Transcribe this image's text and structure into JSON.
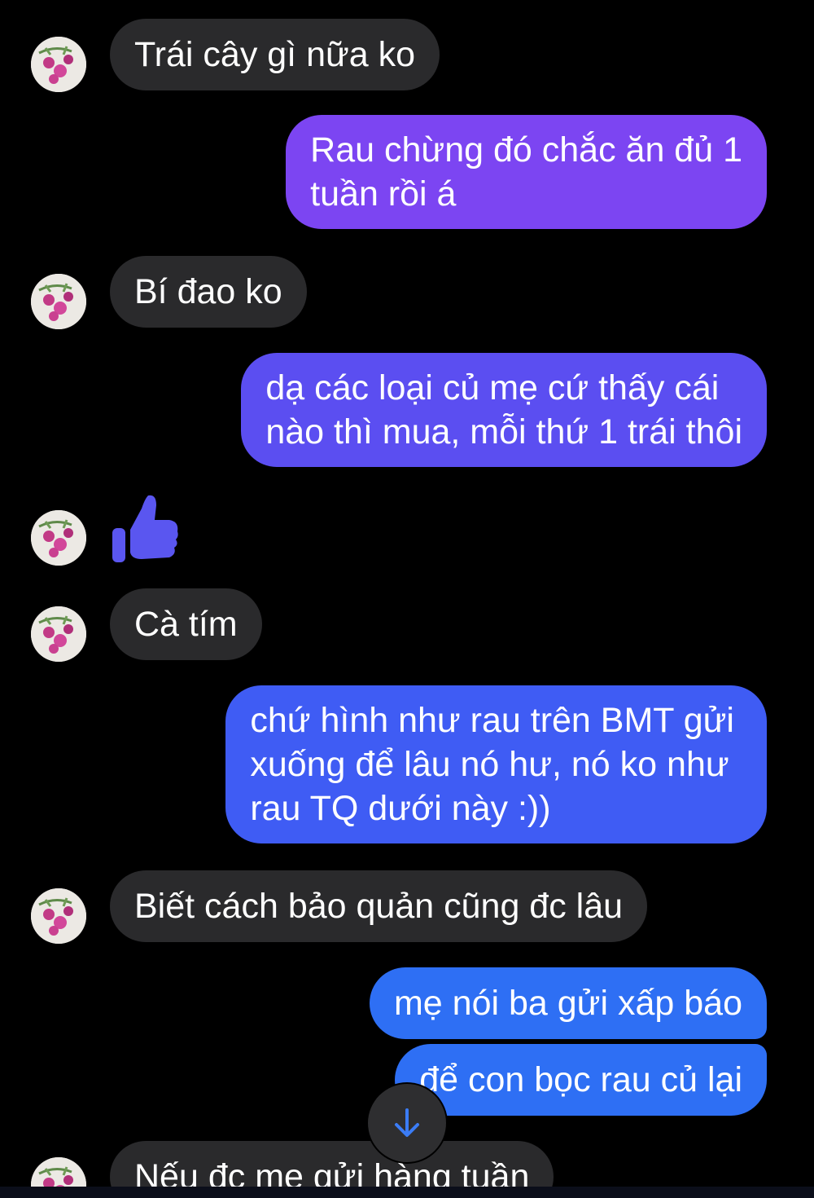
{
  "theme": {
    "incoming_bubble": "#2a2a2c",
    "outgoing_gradient": [
      "#7c45f2",
      "#5b4ef1",
      "#3f5cf4",
      "#2e6ff4"
    ],
    "background": "#000000",
    "like_color": "#5a56f0"
  },
  "messages": [
    {
      "direction": "incoming",
      "text": "Trái cây gì nữa ko"
    },
    {
      "direction": "outgoing",
      "lines": [
        "Rau chừng đó chắc ăn đủ 1",
        "tuần rồi á"
      ]
    },
    {
      "direction": "incoming",
      "text": "Bí đao ko"
    },
    {
      "direction": "outgoing",
      "lines": [
        "dạ các loại củ mẹ cứ thấy cái",
        "nào thì mua, mỗi thứ 1 trái thôi"
      ]
    },
    {
      "direction": "incoming",
      "type": "like",
      "icon": "thumbs-up-icon"
    },
    {
      "direction": "incoming",
      "text": "Cà tím"
    },
    {
      "direction": "outgoing",
      "lines": [
        "chứ hình như rau trên BMT gửi",
        "xuống để lâu nó hư, nó ko như",
        "rau TQ dưới này :))"
      ]
    },
    {
      "direction": "incoming",
      "text": "Biết cách bảo quản cũng đc lâu"
    },
    {
      "direction": "outgoing",
      "text": "mẹ nói ba gửi xấp báo"
    },
    {
      "direction": "outgoing",
      "text": "để con bọc rau củ lại"
    },
    {
      "direction": "incoming",
      "text": "Nếu đc mẹ gửi hàng tuần"
    }
  ],
  "controls": {
    "scroll_down_icon": "arrow-down-icon"
  }
}
